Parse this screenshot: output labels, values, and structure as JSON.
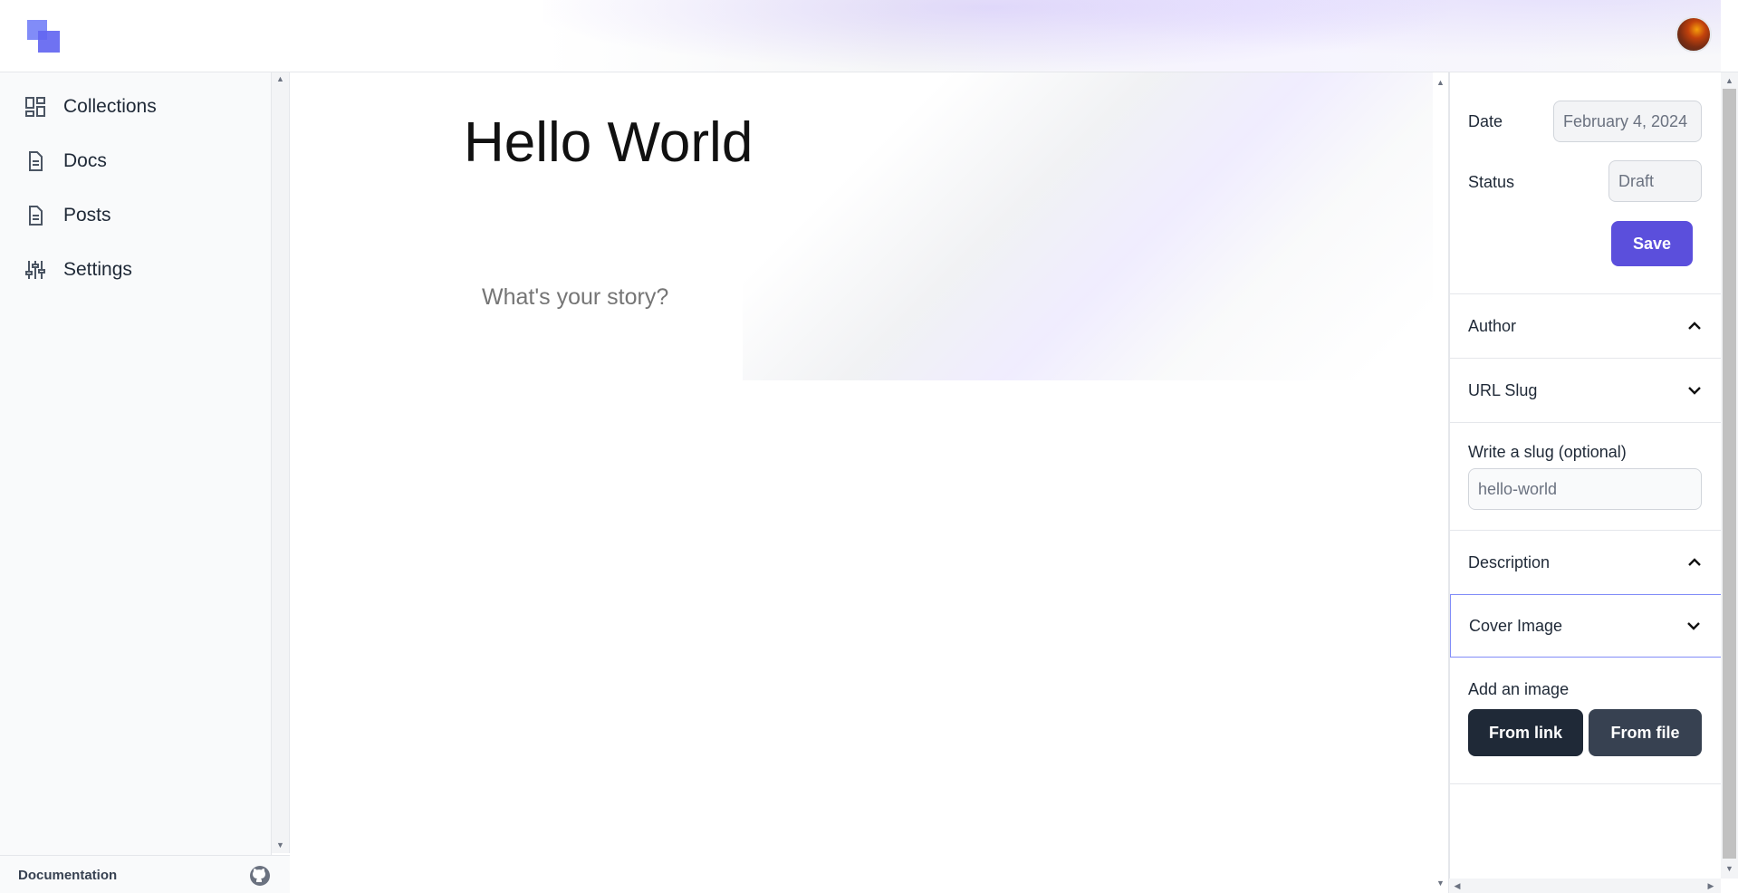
{
  "header": {
    "logo_icon": "logo-squares-icon",
    "avatar_icon": "user-avatar"
  },
  "sidebar": {
    "items": [
      {
        "label": "Collections",
        "icon": "grid-layout-icon"
      },
      {
        "label": "Docs",
        "icon": "document-icon"
      },
      {
        "label": "Posts",
        "icon": "document-icon"
      },
      {
        "label": "Settings",
        "icon": "sliders-icon"
      }
    ],
    "footer": {
      "documentation_label": "Documentation",
      "github_icon": "github-icon"
    }
  },
  "editor": {
    "title": "Hello World",
    "body_placeholder": "What's your story?"
  },
  "panel": {
    "date_label": "Date",
    "date_value": "February 4, 2024",
    "status_label": "Status",
    "status_value": "Draft",
    "save_label": "Save",
    "sections": {
      "author": "Author",
      "url_slug": "URL Slug",
      "description": "Description",
      "cover_image": "Cover Image"
    },
    "slug_hint": "Write a slug (optional)",
    "slug_value": "hello-world",
    "add_image_label": "Add an image",
    "from_link_label": "From link",
    "from_file_label": "From file"
  },
  "colors": {
    "accent": "#5b4fdc",
    "dark_button": "#1f2937",
    "dark_button_2": "#374151"
  }
}
